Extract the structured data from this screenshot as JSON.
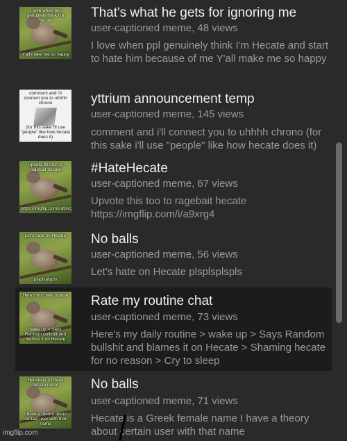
{
  "items": [
    {
      "title": "That's what he gets for ignoring me",
      "meta": "user-captioned meme, 48 views",
      "description": "I love when ppl genuinely think I'm Hecate and start to hate him because of me Y'all make me so happy",
      "thumb_top": "I love when ppl genuinely think I'm Hecate",
      "thumb_bottom": "Y'all make me so happy"
    },
    {
      "title": "yttrium announcement temp",
      "meta": "user-captioned meme, 145 views",
      "description": "comment and i'll connect you to uhhhh chrono (for this sake i'll use \"people\" like how hecate does it)",
      "thumb_top": "comment and i'll connect you to uhhhh chrono",
      "thumb_bottom": "(for this sake i'll use \"people\" like how hecate does it)"
    },
    {
      "title": "#HateHecate",
      "meta": "user-captioned meme, 67 views",
      "description": "Upvote this too to ragebait hecate https://imgflip.com/i/a9xrg4",
      "thumb_top": "Upvote this too to ragebait hecate",
      "thumb_bottom": "https://imgflip.com/i/a9xrg4"
    },
    {
      "title": "No balls",
      "meta": "user-captioned meme, 56 views",
      "description": "Let's hate on Hecate plsplsplspls",
      "thumb_top": "Let's hate on Hecate",
      "thumb_bottom": "plsplsplspls"
    },
    {
      "title": "Rate my routine chat",
      "meta": "user-captioned meme, 73 views",
      "description": "Here's my daily routine > wake up > Says Random bullshit and blames it on Hecate > Shaming hecate for no reason > Cry to sleep",
      "thumb_top": "Here's my daily routine",
      "thumb_bottom": "wake up > Says Random bullshit and blames it on Hecate"
    },
    {
      "title": "No balls",
      "meta": "user-captioned meme, 71 views",
      "description": "Hecate is a Greek female name I have a theory about certain user with that name",
      "thumb_top": "Hecate is a Greek female name",
      "thumb_bottom": "I have a theory about certain user with that name"
    }
  ],
  "watermark": "imgflip.com"
}
